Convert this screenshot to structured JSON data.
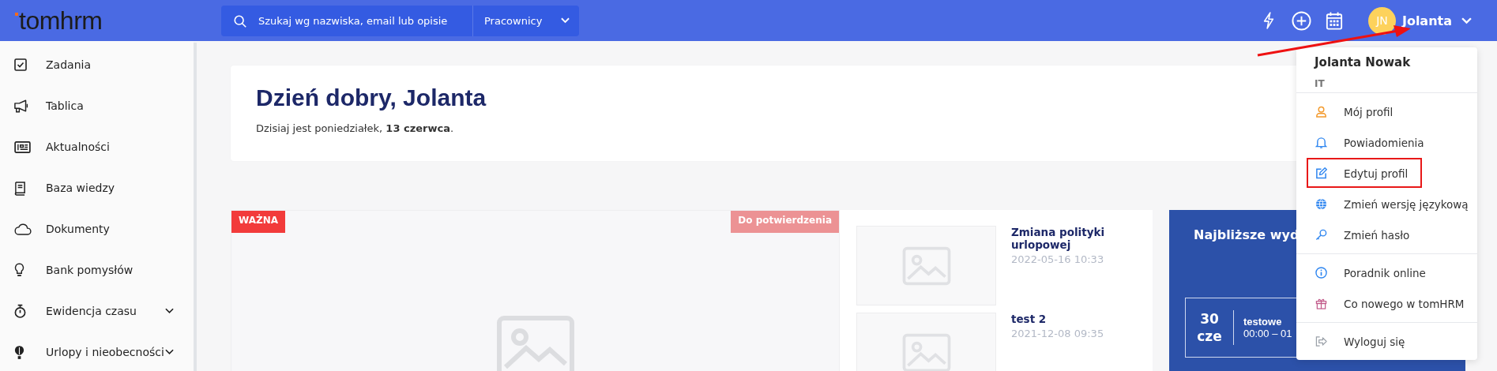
{
  "header": {
    "logo": "tomhrm",
    "search": {
      "placeholder": "Szukaj wg nazwiska, email lub opisie",
      "scope": "Pracownicy"
    },
    "user": {
      "initials": "JN",
      "name": "Jolanta"
    }
  },
  "sidebar": {
    "items": [
      {
        "label": "Zadania",
        "expandable": false
      },
      {
        "label": "Tablica",
        "expandable": false
      },
      {
        "label": "Aktualności",
        "expandable": false
      },
      {
        "label": "Baza wiedzy",
        "expandable": false
      },
      {
        "label": "Dokumenty",
        "expandable": false
      },
      {
        "label": "Bank pomysłów",
        "expandable": false
      },
      {
        "label": "Ewidencja czasu",
        "expandable": true
      },
      {
        "label": "Urlopy i nieobecności",
        "expandable": true
      }
    ]
  },
  "greeting": {
    "title": "Dzień dobry, Jolanta",
    "subtitle": "Dzisiaj jest poniedziałek, **13 czerwca**."
  },
  "featured": {
    "badges": [
      {
        "label": "WAŻNA",
        "color": "#f23b3b"
      },
      {
        "label": "Do potwierdzenia",
        "color": "#ec9294"
      }
    ]
  },
  "news": [
    {
      "title": "Zmiana polityki urlopowej",
      "date": "2022-05-16 10:33"
    },
    {
      "title": "test 2",
      "date": "2021-12-08 09:35"
    }
  ],
  "events_panel": {
    "title": "Najbliższe wyd",
    "events": [
      {
        "day": "30",
        "month": "cze",
        "title": "testowe",
        "time": "00:00 – 01"
      }
    ]
  },
  "user_menu": {
    "name": "Jolanta Nowak",
    "department": "IT",
    "sections": [
      {
        "items": [
          {
            "label": "Mój profil",
            "highlighted": false
          },
          {
            "label": "Powiadomienia",
            "highlighted": false
          },
          {
            "label": "Edytuj profil",
            "highlighted": true
          },
          {
            "label": "Zmień wersję językową",
            "highlighted": false
          },
          {
            "label": "Zmień hasło",
            "highlighted": false
          }
        ]
      },
      {
        "items": [
          {
            "label": "Poradnik online",
            "highlighted": false
          },
          {
            "label": "Co nowego w tomHRM",
            "highlighted": false
          }
        ]
      },
      {
        "items": [
          {
            "label": "Wyloguj się",
            "highlighted": false
          }
        ]
      }
    ]
  }
}
